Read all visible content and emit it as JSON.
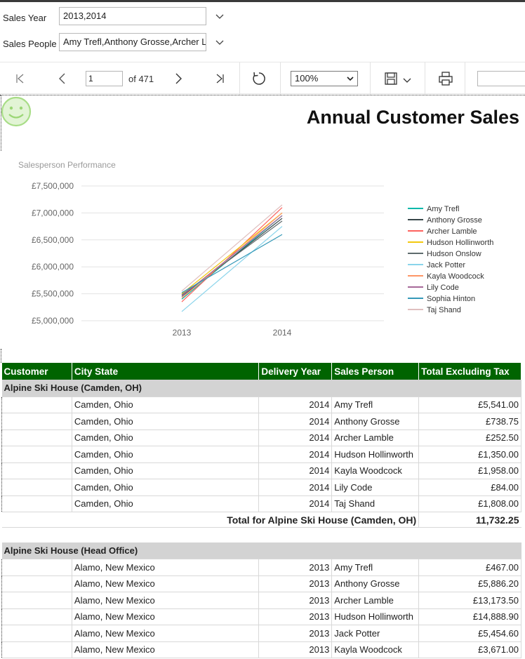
{
  "params": {
    "sales_year_label": "Sales Year",
    "sales_year_value": "2013,2014",
    "sales_people_label": "Sales People",
    "sales_people_value": "Amy Trefl,Anthony Grosse,Archer L"
  },
  "toolbar": {
    "page_value": "1",
    "page_of": "of 471",
    "zoom": "100%",
    "icons": [
      "first-page-icon",
      "prev-page-icon",
      "next-page-icon",
      "last-page-icon",
      "refresh-icon",
      "save-icon",
      "print-icon"
    ]
  },
  "report": {
    "title": "Annual Customer Sales"
  },
  "chart_data": {
    "type": "line",
    "title": "Salesperson Performance",
    "categories": [
      "2013",
      "2014"
    ],
    "ylim": [
      5000000,
      7500000
    ],
    "yticks": [
      "£5,000,000",
      "£5,500,000",
      "£6,000,000",
      "£6,500,000",
      "£7,000,000",
      "£7,500,000"
    ],
    "ytick_values": [
      5000000,
      5500000,
      6000000,
      6500000,
      7000000,
      7500000
    ],
    "legend_position": "right",
    "series": [
      {
        "name": "Amy Trefl",
        "color": "#01b8aa",
        "values": [
          5400000,
          6950000
        ]
      },
      {
        "name": "Anthony Grosse",
        "color": "#374649",
        "values": [
          5450000,
          6900000
        ]
      },
      {
        "name": "Archer Lamble",
        "color": "#fd625e",
        "values": [
          5350000,
          7100000
        ]
      },
      {
        "name": "Hudson Hollinworth",
        "color": "#f2c80f",
        "values": [
          5500000,
          7000000
        ]
      },
      {
        "name": "Hudson Onslow",
        "color": "#5f6b6d",
        "values": [
          5480000,
          6850000
        ]
      },
      {
        "name": "Jack Potter",
        "color": "#8ad4eb",
        "values": [
          5170000,
          6750000
        ]
      },
      {
        "name": "Kayla Woodcock",
        "color": "#fe9666",
        "values": [
          5420000,
          7000000
        ]
      },
      {
        "name": "Lily Code",
        "color": "#a66999",
        "values": [
          5460000,
          6950000
        ]
      },
      {
        "name": "Sophia Hinton",
        "color": "#3599b8",
        "values": [
          5520000,
          6600000
        ]
      },
      {
        "name": "Taj Shand",
        "color": "#dfbfbf",
        "values": [
          5550000,
          7150000
        ]
      }
    ]
  },
  "table": {
    "headers": [
      "Customer",
      "City State",
      "Delivery Year",
      "Sales Person",
      "Total Excluding Tax"
    ],
    "groups": [
      {
        "name": "Alpine Ski House (Camden, OH)",
        "rows": [
          {
            "city": "Camden, Ohio",
            "year": "2014",
            "person": "Amy Trefl",
            "total": "£5,541.00"
          },
          {
            "city": "Camden, Ohio",
            "year": "2014",
            "person": "Anthony Grosse",
            "total": "£738.75"
          },
          {
            "city": "Camden, Ohio",
            "year": "2014",
            "person": "Archer Lamble",
            "total": "£252.50"
          },
          {
            "city": "Camden, Ohio",
            "year": "2014",
            "person": "Hudson Hollinworth",
            "total": "£1,350.00"
          },
          {
            "city": "Camden, Ohio",
            "year": "2014",
            "person": "Kayla Woodcock",
            "total": "£1,958.00"
          },
          {
            "city": "Camden, Ohio",
            "year": "2014",
            "person": "Lily Code",
            "total": "£84.00"
          },
          {
            "city": "Camden, Ohio",
            "year": "2014",
            "person": "Taj Shand",
            "total": "£1,808.00"
          }
        ],
        "total_label": "Total for Alpine Ski House (Camden, OH)",
        "total_value": "11,732.25"
      },
      {
        "name": "Alpine Ski House (Head Office)",
        "rows": [
          {
            "city": "Alamo, New Mexico",
            "year": "2013",
            "person": "Amy Trefl",
            "total": "£467.00"
          },
          {
            "city": "Alamo, New Mexico",
            "year": "2013",
            "person": "Anthony Grosse",
            "total": "£5,886.20"
          },
          {
            "city": "Alamo, New Mexico",
            "year": "2013",
            "person": "Archer Lamble",
            "total": "£13,173.50"
          },
          {
            "city": "Alamo, New Mexico",
            "year": "2013",
            "person": "Hudson Hollinworth",
            "total": "£14,888.90"
          },
          {
            "city": "Alamo, New Mexico",
            "year": "2013",
            "person": "Jack Potter",
            "total": "£5,454.60"
          },
          {
            "city": "Alamo, New Mexico",
            "year": "2013",
            "person": "Kayla Woodcock",
            "total": "£3,671.00"
          }
        ]
      }
    ]
  }
}
